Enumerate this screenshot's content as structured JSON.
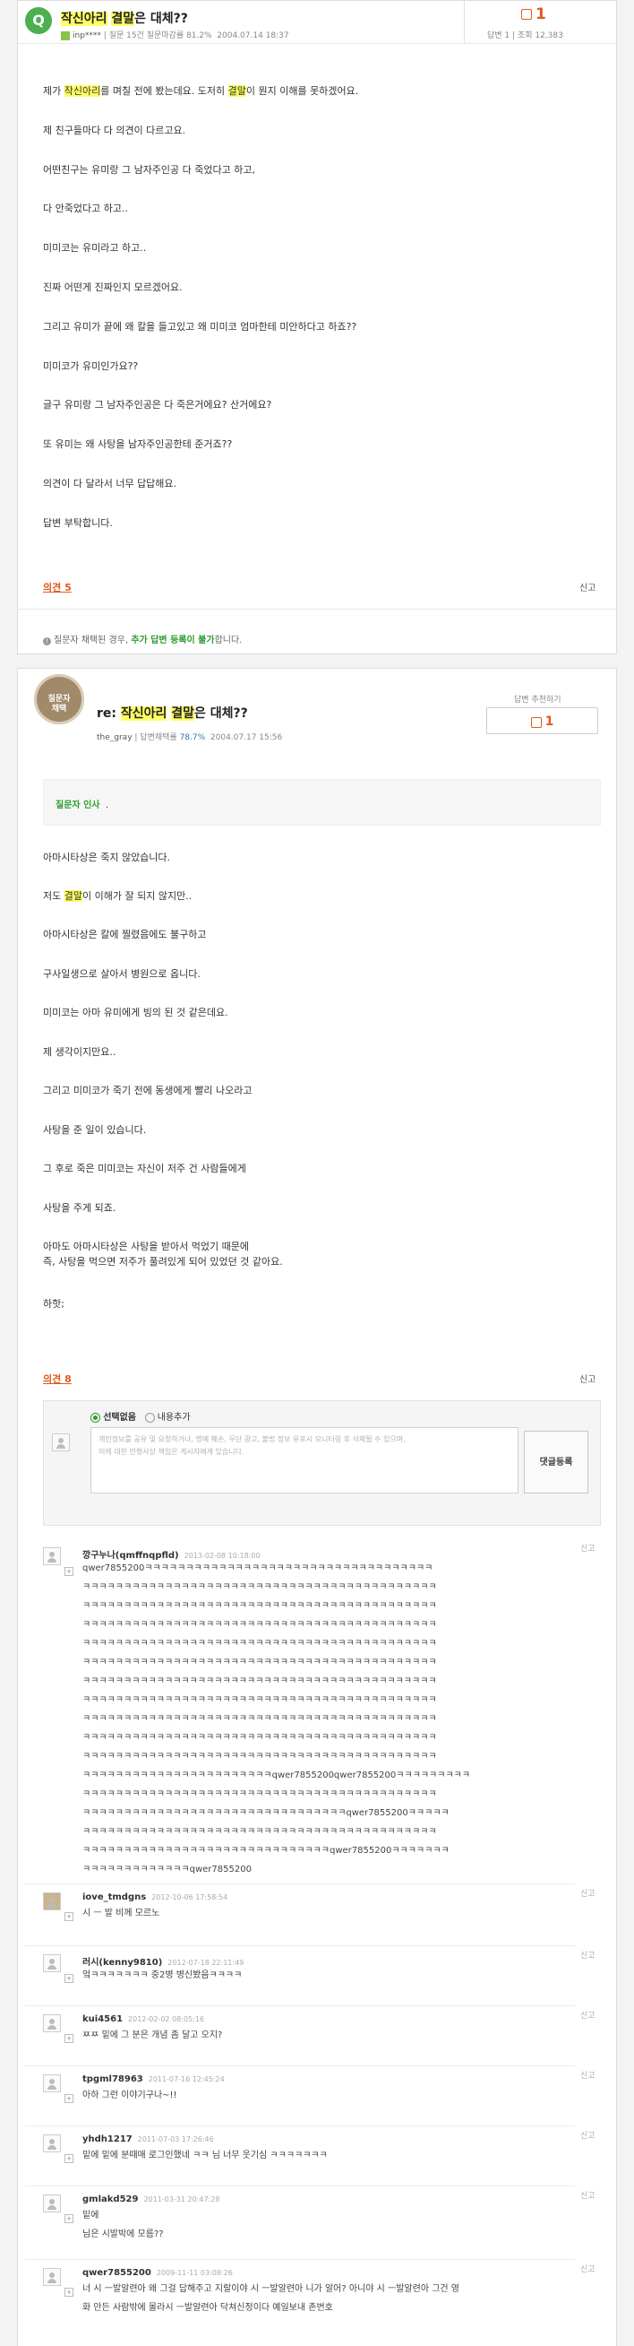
{
  "question": {
    "badge": "Q",
    "title_pre": "작신아리",
    "title_mid": " ",
    "title_hl": "결말",
    "title_post": "은 대체??",
    "user": "inp****",
    "meta": "질문 15건 질문마감률 81.2%",
    "date": "2004.07.14 18:37",
    "vote_count": "1",
    "answers_label": "답변 1",
    "views_label": "조회 12,383",
    "paragraphs": [
      "제가 작신아리를 며칠 전에 봤는데요. 도저히 결말이 뭔지 이해를 못하겠어요.",
      "제 친구들마다 다 의견이 다르고요.",
      "어떤친구는 유미랑 그 남자주인공 다 죽었다고 하고,",
      "다 안죽었다고 하고..",
      "미미코는 유미라고 하고..",
      "진짜 어떤게 진짜인지 모르겠어요.",
      "그리고 유미가 끝에 왜 칼을 들고있고 왜 미미코 엄마한테 미안하다고 하죠??",
      "미미코가 유미인가요??",
      "글구 유미랑 그 남자주인공은 다 죽은거에요? 산거에요?",
      "또 유미는 왜 사탕을 남자주인공한테 준거죠??",
      "의견이 다 달라서 너무 답답해요.",
      "답변 부탁합니다."
    ],
    "opinion_label": "의견 5",
    "report_label": "신고",
    "notice_pre": "질문자 채택된 경우, ",
    "notice_hl": "추가 답변 등록이 불가",
    "notice_post": "합니다."
  },
  "answer": {
    "badge_line1": "질문자",
    "badge_line2": "채택",
    "title_prefix": "re: ",
    "title_a": "작신아리",
    "title_b": "결말",
    "title_c": "은 대체??",
    "user": "the_gray",
    "meta_label": "답변채택률",
    "rate": "78.7%",
    "date": "2004.07.17 15:56",
    "recommend_label": "답변 추천하기",
    "vote_count": "1",
    "thanks_label": "질문자 인사",
    "thanks_text": ".",
    "paragraphs": [
      "아마시타상은 죽지 않았습니다.",
      "저도 결말이 이해가 잘 되지 않지만..",
      "아마시타상은 칼에 찔렸음에도 불구하고",
      "구사일생으로 살아서 병원으로 옵니다.",
      "미미코는 아마 유미에게 빙의 된 것 같은데요.",
      "제 생각이지만요..",
      "그리고 미미코가 죽기 전에 동생에게 빨리 나오라고",
      "사탕을 준 일이 있습니다.",
      "그 후로 죽은 미미코는 자신이 저주 건 사람들에게",
      "사탕을 주게 되죠.",
      "아마도 아마시타상은 사탕을 받아서 먹었기 때문에",
      "즉, 사탕을 먹으면 저주가 풀려있게 되어 있었던 것 같아요.",
      "하핫;"
    ],
    "opinion_label": "의견 8",
    "report_label": "신고"
  },
  "reply_form": {
    "radio_none": "선택없음",
    "radio_add": "내용추가",
    "placeholder_line1": "개인정보를 공유 및 요청하거나, 명예 훼손, 무단 광고, 불법 정보 유포시 모니터링 후 삭제될 수 있으며,",
    "placeholder_line2": "이에 대한 민형사상 책임은 게시자에게 있습니다.",
    "submit_label": "댓글등록"
  },
  "comments": [
    {
      "name": "깡구누나(qmffnqpfld)",
      "date": "2013-02-08 10:18:00",
      "lines": [
        "qwer7855200ㅋㅋㅋㅋㅋㅋㅋㅋㅋㅋㅋㅋㅋㅋㅋㅋㅋㅋㅋㅋㅋㅋㅋㅋㅋㅋㅋㅋㅋㅋㅋㅋㅋㅋㅋ",
        "ㅋㅋㅋㅋㅋㅋㅋㅋㅋㅋㅋㅋㅋㅋㅋㅋㅋㅋㅋㅋㅋㅋㅋㅋㅋㅋㅋㅋㅋㅋㅋㅋㅋㅋㅋㅋㅋㅋㅋㅋㅋㅋㅋ",
        "ㅋㅋㅋㅋㅋㅋㅋㅋㅋㅋㅋㅋㅋㅋㅋㅋㅋㅋㅋㅋㅋㅋㅋㅋㅋㅋㅋㅋㅋㅋㅋㅋㅋㅋㅋㅋㅋㅋㅋㅋㅋㅋㅋ",
        "ㅋㅋㅋㅋㅋㅋㅋㅋㅋㅋㅋㅋㅋㅋㅋㅋㅋㅋㅋㅋㅋㅋㅋㅋㅋㅋㅋㅋㅋㅋㅋㅋㅋㅋㅋㅋㅋㅋㅋㅋㅋㅋㅋ",
        "ㅋㅋㅋㅋㅋㅋㅋㅋㅋㅋㅋㅋㅋㅋㅋㅋㅋㅋㅋㅋㅋㅋㅋㅋㅋㅋㅋㅋㅋㅋㅋㅋㅋㅋㅋㅋㅋㅋㅋㅋㅋㅋㅋ",
        "ㅋㅋㅋㅋㅋㅋㅋㅋㅋㅋㅋㅋㅋㅋㅋㅋㅋㅋㅋㅋㅋㅋㅋㅋㅋㅋㅋㅋㅋㅋㅋㅋㅋㅋㅋㅋㅋㅋㅋㅋㅋㅋㅋ",
        "ㅋㅋㅋㅋㅋㅋㅋㅋㅋㅋㅋㅋㅋㅋㅋㅋㅋㅋㅋㅋㅋㅋㅋㅋㅋㅋㅋㅋㅋㅋㅋㅋㅋㅋㅋㅋㅋㅋㅋㅋㅋㅋㅋ",
        "ㅋㅋㅋㅋㅋㅋㅋㅋㅋㅋㅋㅋㅋㅋㅋㅋㅋㅋㅋㅋㅋㅋㅋㅋㅋㅋㅋㅋㅋㅋㅋㅋㅋㅋㅋㅋㅋㅋㅋㅋㅋㅋㅋ",
        "ㅋㅋㅋㅋㅋㅋㅋㅋㅋㅋㅋㅋㅋㅋㅋㅋㅋㅋㅋㅋㅋㅋㅋㅋㅋㅋㅋㅋㅋㅋㅋㅋㅋㅋㅋㅋㅋㅋㅋㅋㅋㅋㅋ",
        "ㅋㅋㅋㅋㅋㅋㅋㅋㅋㅋㅋㅋㅋㅋㅋㅋㅋㅋㅋㅋㅋㅋㅋㅋㅋㅋㅋㅋㅋㅋㅋㅋㅋㅋㅋㅋㅋㅋㅋㅋㅋㅋㅋ",
        "ㅋㅋㅋㅋㅋㅋㅋㅋㅋㅋㅋㅋㅋㅋㅋㅋㅋㅋㅋㅋㅋㅋㅋㅋㅋㅋㅋㅋㅋㅋㅋㅋㅋㅋㅋㅋㅋㅋㅋㅋㅋㅋㅋ",
        "ㅋㅋㅋㅋㅋㅋㅋㅋㅋㅋㅋㅋㅋㅋㅋㅋㅋㅋㅋㅋㅋㅋㅋqwer7855200qwer7855200ㅋㅋㅋㅋㅋㅋㅋㅋㅋ",
        "ㅋㅋㅋㅋㅋㅋㅋㅋㅋㅋㅋㅋㅋㅋㅋㅋㅋㅋㅋㅋㅋㅋㅋㅋㅋㅋㅋㅋㅋㅋㅋㅋㅋㅋㅋㅋㅋㅋㅋㅋㅋㅋㅋ",
        "ㅋㅋㅋㅋㅋㅋㅋㅋㅋㅋㅋㅋㅋㅋㅋㅋㅋㅋㅋㅋㅋㅋㅋㅋㅋㅋㅋㅋㅋㅋㅋㅋqwer7855200ㅋㅋㅋㅋㅋ",
        "ㅋㅋㅋㅋㅋㅋㅋㅋㅋㅋㅋㅋㅋㅋㅋㅋㅋㅋㅋㅋㅋㅋㅋㅋㅋㅋㅋㅋㅋㅋㅋㅋㅋㅋㅋㅋㅋㅋㅋㅋㅋㅋㅋ",
        "ㅋㅋㅋㅋㅋㅋㅋㅋㅋㅋㅋㅋㅋㅋㅋㅋㅋㅋㅋㅋㅋㅋㅋㅋㅋㅋㅋㅋㅋㅋqwer7855200ㅋㅋㅋㅋㅋㅋㅋ",
        "ㅋㅋㅋㅋㅋㅋㅋㅋㅋㅋㅋㅋㅋqwer7855200"
      ]
    },
    {
      "name": "iove_tmdgns",
      "date": "2012-10-06 17:58:54",
      "lines": [
        "시 ㅡ 발 비께 모르노"
      ]
    },
    {
      "name": "러시(kenny9810)",
      "date": "2012-07-18 22:11:49",
      "lines": [
        "엌ㅋㅋㅋㅋㅋㅋㅋ 중2병 병신봤음ㅋㅋㅋㅋ"
      ]
    },
    {
      "name": "kui4561",
      "date": "2012-02-02 08:05:16",
      "lines": [
        "ㅉㅉ 밑에 그 분은 개념 좀 달고 오지?"
      ]
    },
    {
      "name": "tpgml78963",
      "date": "2011-07-16 12:45:24",
      "lines": [
        "아하 그런 이야기구나~!!"
      ]
    },
    {
      "name": "yhdh1217",
      "date": "2011-07-03 17:26:46",
      "lines": [
        "밑에 밑에 분때매 로그인했네 ㅋㅋ 님 너무 웃기심 ㅋㅋㅋㅋㅋㅋㅋ"
      ]
    },
    {
      "name": "gmlakd529",
      "date": "2011-03-31 20:47:28",
      "lines": [
        "밑에",
        "님은 시발박에 모름??"
      ]
    },
    {
      "name": "qwer7855200",
      "date": "2009-11-11 03:08:26",
      "lines": [
        "너 시 ㅡ발알련아 왜 그걸 답해주고 지랄이야 시 ㅡ발알련아 니가 알어? 아니야 시 ㅡ발알련아 그건 영",
        "화 만든 사람밖에 몰라시 ㅡ발알련아 닥쳐신정이다 예일보내 존번호"
      ]
    }
  ]
}
